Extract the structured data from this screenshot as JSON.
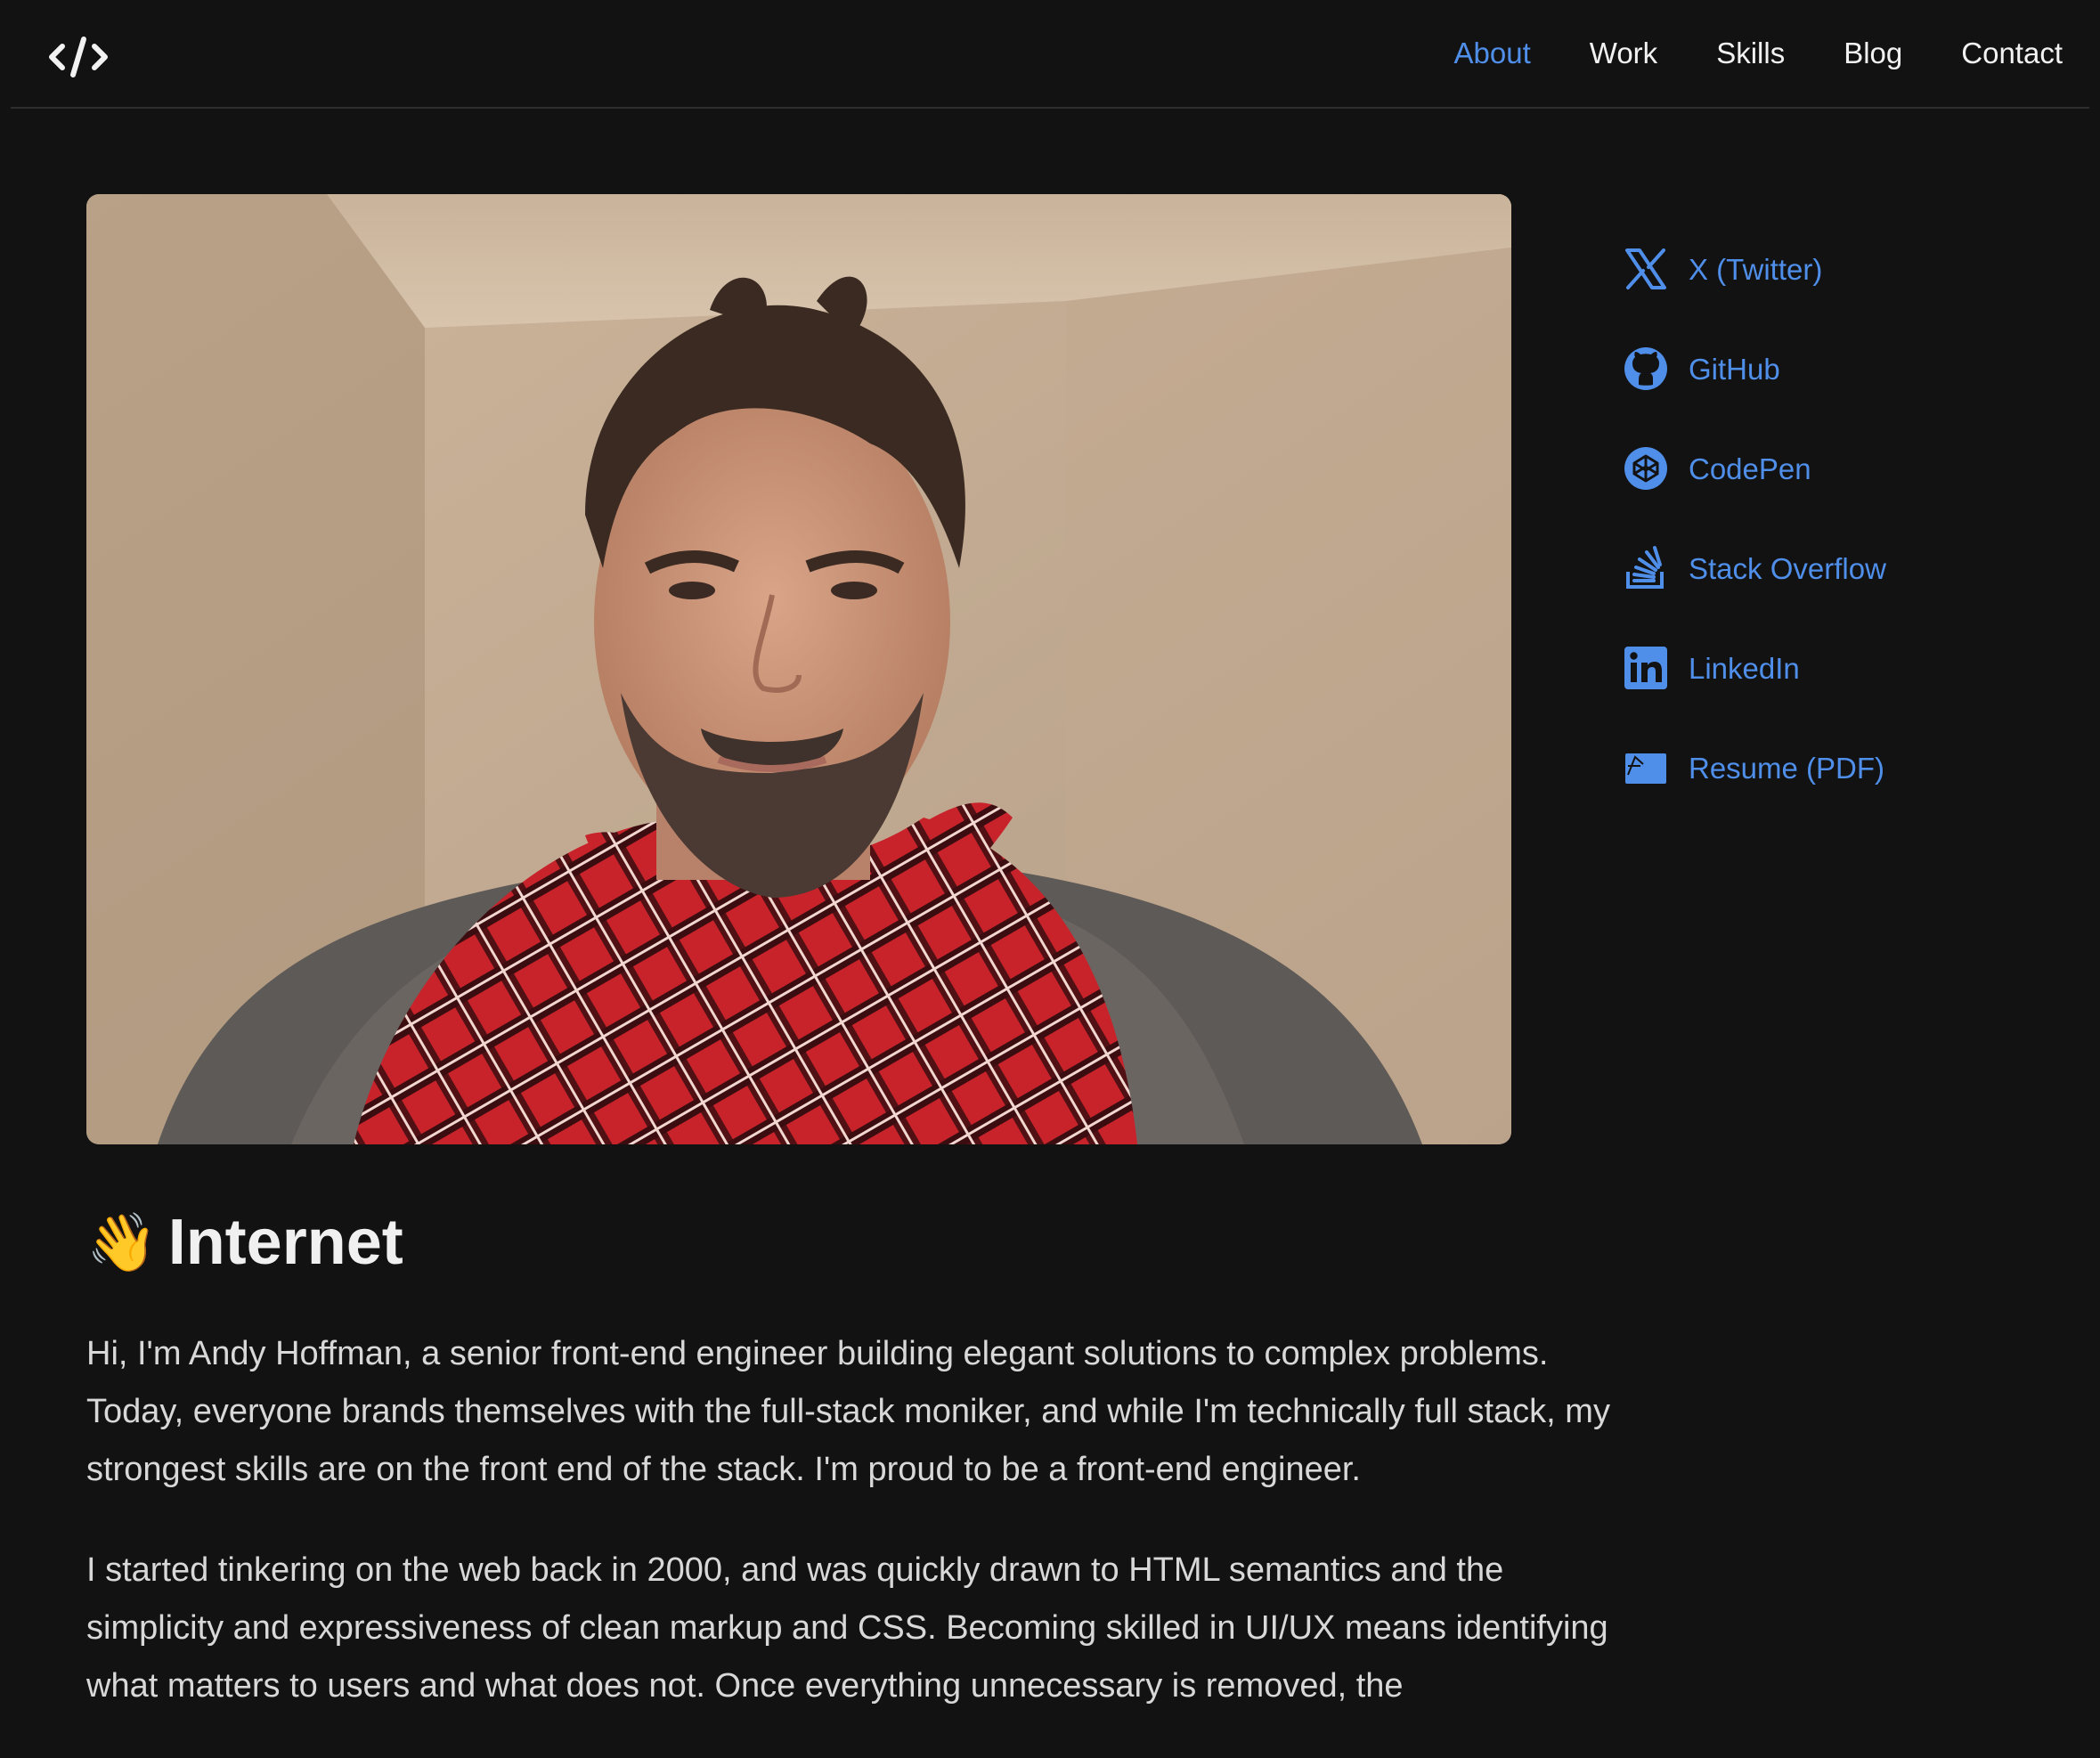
{
  "nav": {
    "logo_label": "</>",
    "items": [
      {
        "label": "About",
        "active": true
      },
      {
        "label": "Work",
        "active": false
      },
      {
        "label": "Skills",
        "active": false
      },
      {
        "label": "Blog",
        "active": false
      },
      {
        "label": "Contact",
        "active": false
      }
    ]
  },
  "colors": {
    "background": "#121212",
    "accent": "#4f8fea",
    "text": "#e6e6e6"
  },
  "photo": {
    "subject": "portrait photo of a smiling bearded man wearing a red plaid scarf"
  },
  "social": [
    {
      "icon": "x-twitter-icon",
      "label": "X (Twitter)"
    },
    {
      "icon": "github-icon",
      "label": "GitHub"
    },
    {
      "icon": "codepen-icon",
      "label": "CodePen"
    },
    {
      "icon": "stack-overflow-icon",
      "label": "Stack Overflow"
    },
    {
      "icon": "linkedin-icon",
      "label": "LinkedIn"
    },
    {
      "icon": "resume-pdf-icon",
      "label": "Resume (PDF)"
    }
  ],
  "intro": {
    "emoji": "👋",
    "title": "Internet",
    "paragraphs": [
      "Hi, I'm Andy Hoffman, a senior front-end engineer building elegant solutions to complex problems. Today, everyone brands themselves with the full-stack moniker, and while I'm technically full stack, my strongest skills are on the front end of the stack. I'm proud to be a front-end engineer.",
      "I started tinkering on the web back in 2000, and was quickly drawn to HTML semantics and the simplicity and expressiveness of clean markup and CSS. Becoming skilled in UI/UX means identifying what matters to users and what does not. Once everything unnecessary is removed, the"
    ]
  }
}
